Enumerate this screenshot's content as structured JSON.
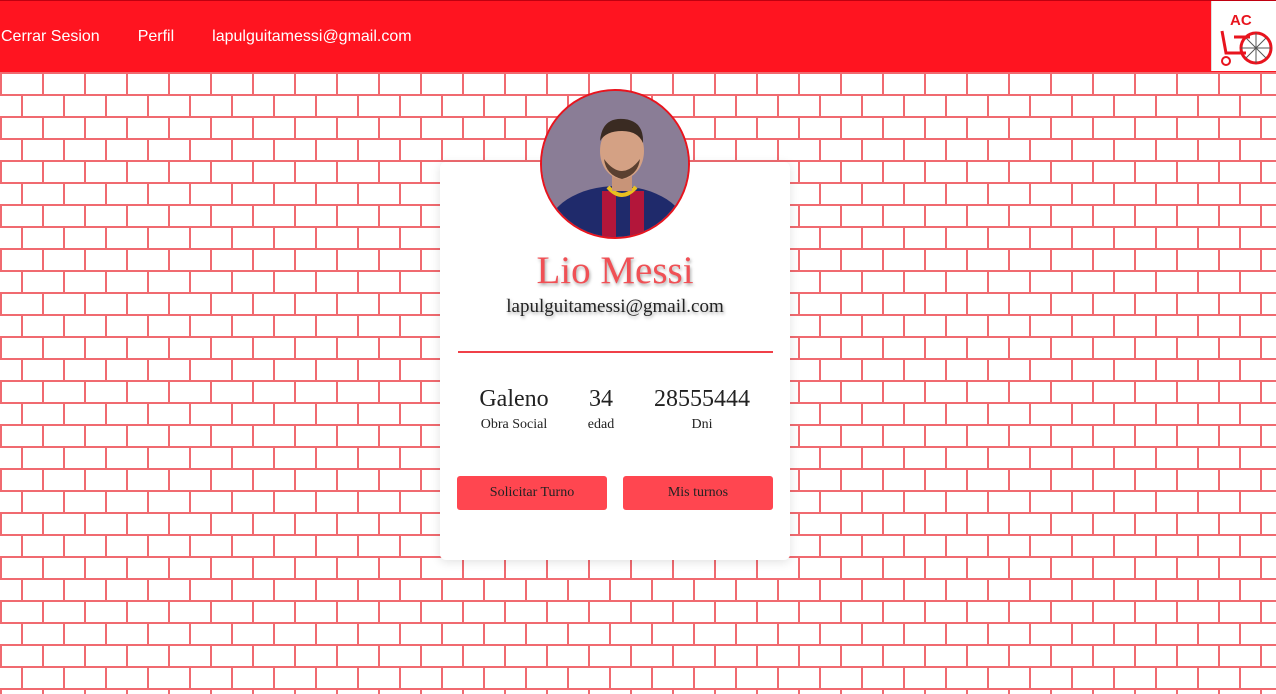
{
  "nav": {
    "links": [
      {
        "label": "Cerrar Sesion"
      },
      {
        "label": "Perfil"
      },
      {
        "label": "lapulguitamessi@gmail.com"
      }
    ],
    "logo_text": "AC"
  },
  "profile": {
    "name": "Lio Messi",
    "email": "lapulguitamessi@gmail.com",
    "stats": [
      {
        "value": "Galeno",
        "label": "Obra Social"
      },
      {
        "value": "34",
        "label": "edad"
      },
      {
        "value": "28555444",
        "label": "Dni"
      }
    ],
    "buttons": {
      "request": "Solicitar Turno",
      "my_turns": "Mis turnos"
    }
  },
  "colors": {
    "navbar": "#ff1420",
    "accent": "#ff4650",
    "brick_lines": "#f06a70"
  }
}
